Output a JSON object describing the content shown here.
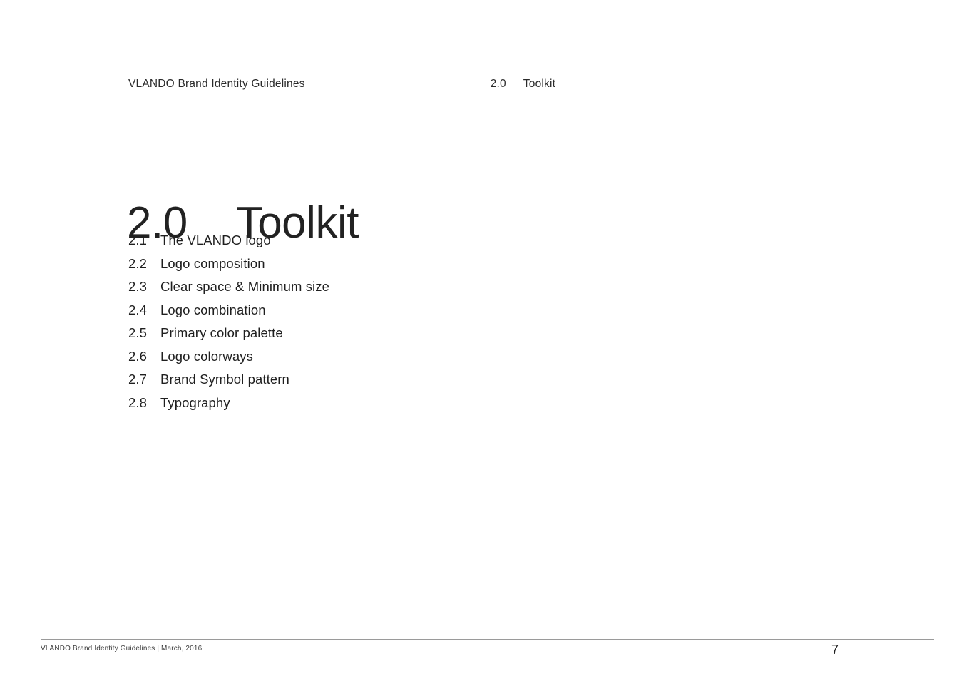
{
  "header": {
    "document_title": "VLANDO Brand Identity Guidelines",
    "section_number": "2.0",
    "section_name": "Toolkit"
  },
  "title": {
    "number": "2.0",
    "name": "Toolkit"
  },
  "toc": {
    "items": [
      {
        "number": "2.1",
        "label": "The VLANDO logo"
      },
      {
        "number": "2.2",
        "label": "Logo composition"
      },
      {
        "number": "2.3",
        "label": "Clear space & Minimum size"
      },
      {
        "number": "2.4",
        "label": "Logo combination"
      },
      {
        "number": "2.5",
        "label": "Primary color palette"
      },
      {
        "number": "2.6",
        "label": "Logo colorways"
      },
      {
        "number": "2.7",
        "label": "Brand Symbol pattern"
      },
      {
        "number": "2.8",
        "label": "Typography"
      }
    ]
  },
  "footer": {
    "text": "VLANDO Brand Identity Guidelines | March, 2016",
    "page_number": "7",
    "rule_color": "#9a9a9a"
  },
  "colors": {
    "background": "#ffffff",
    "text": "#1a1a1a",
    "muted_text": "#3d3d3d"
  }
}
